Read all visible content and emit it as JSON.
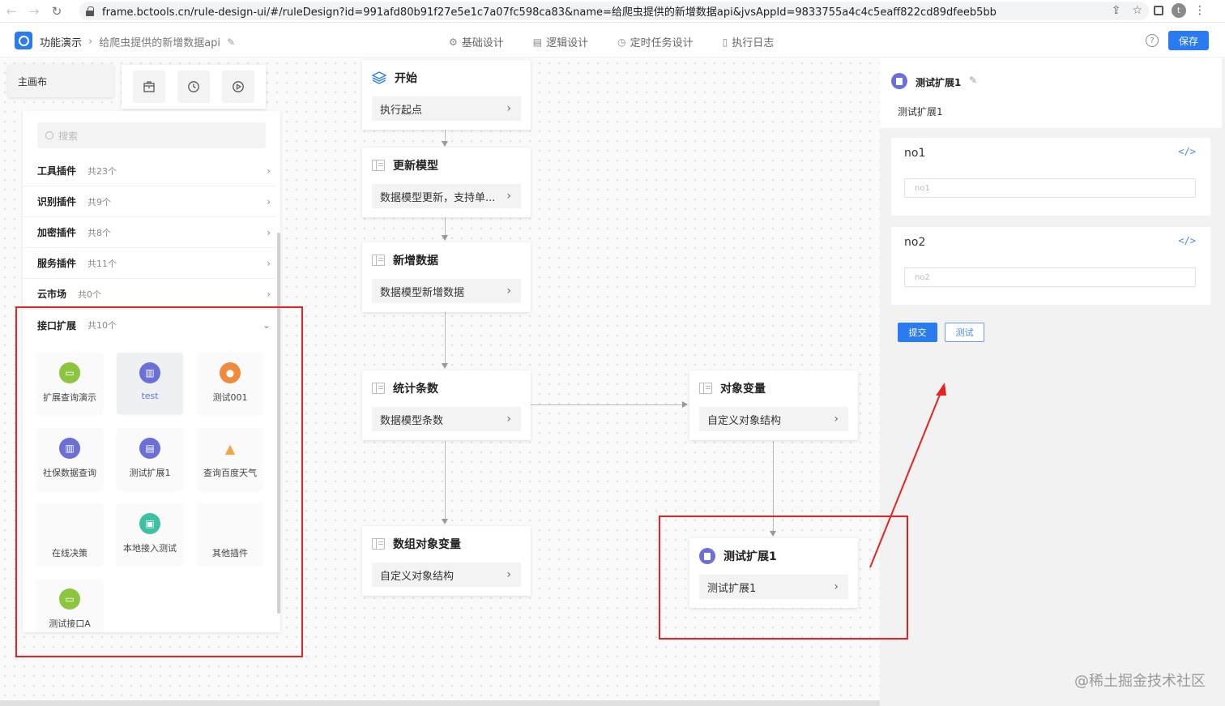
{
  "browser": {
    "url": "frame.bctools.cn/rule-design-ui/#/ruleDesign?id=991afd80b91f27e5e1c7a07fc598ca83&name=给爬虫提供的新增数据api&jvsAppId=9833755a4c4c5eaff822cd89dfeeb5bb",
    "avatar_letter": "t"
  },
  "header": {
    "breadcrumb_root": "功能演示",
    "breadcrumb_current": "给爬虫提供的新增数据api",
    "tabs": [
      "基础设计",
      "逻辑设计",
      "定时任务设计",
      "执行日志"
    ],
    "save_label": "保存"
  },
  "canvas": {
    "tab_label": "主画布"
  },
  "plugin_panel": {
    "search_placeholder": "搜索",
    "categories": [
      {
        "name": "工具插件",
        "count": "共23个"
      },
      {
        "name": "识别插件",
        "count": "共9个"
      },
      {
        "name": "加密插件",
        "count": "共8个"
      },
      {
        "name": "服务插件",
        "count": "共11个"
      },
      {
        "name": "云市场",
        "count": "共0个"
      },
      {
        "name": "接口扩展",
        "count": "共10个"
      }
    ],
    "plugins": [
      {
        "label": "扩展查询演示",
        "icon": "chat-icon",
        "color": "#8cc63e"
      },
      {
        "label": "test",
        "icon": "chart-icon",
        "color": "#6b6fd8"
      },
      {
        "label": "测试001",
        "icon": "people-icon",
        "color": "#f08a3c"
      },
      {
        "label": "社保数据查询",
        "icon": "chart-icon",
        "color": "#6b6fd8"
      },
      {
        "label": "测试扩展1",
        "icon": "doc-icon",
        "color": "#6b6fd8"
      },
      {
        "label": "查询百度天气",
        "icon": "alert-icon",
        "color": "#f4a445"
      },
      {
        "label": "在线决策",
        "icon": "",
        "color": ""
      },
      {
        "label": "本地接入测试",
        "icon": "id-card-icon",
        "color": "#3ec1a0"
      },
      {
        "label": "其他插件",
        "icon": "",
        "color": ""
      },
      {
        "label": "测试接口A",
        "icon": "chat-icon",
        "color": "#8cc63e"
      }
    ]
  },
  "flow": {
    "nodes": [
      {
        "title": "开始",
        "body": "执行起点"
      },
      {
        "title": "更新模型",
        "body": "数据模型更新，支持单..."
      },
      {
        "title": "新增数据",
        "body": "数据模型新增数据"
      },
      {
        "title": "统计条数",
        "body": "数据模型条数"
      },
      {
        "title": "数组对象变量",
        "body": "自定义对象结构"
      },
      {
        "title": "对象变量",
        "body": "自定义对象结构"
      },
      {
        "title": "测试扩展1",
        "body": "测试扩展1"
      }
    ]
  },
  "right_panel": {
    "title": "测试扩展1",
    "subtitle": "测试扩展1",
    "fields": [
      {
        "label": "no1",
        "placeholder": "no1"
      },
      {
        "label": "no2",
        "placeholder": "no2"
      }
    ],
    "submit_label": "提交",
    "test_label": "测试"
  },
  "watermark": "@稀土掘金技术社区",
  "colors": {
    "accent": "#2b7bf0",
    "highlight": "#e8231f"
  }
}
